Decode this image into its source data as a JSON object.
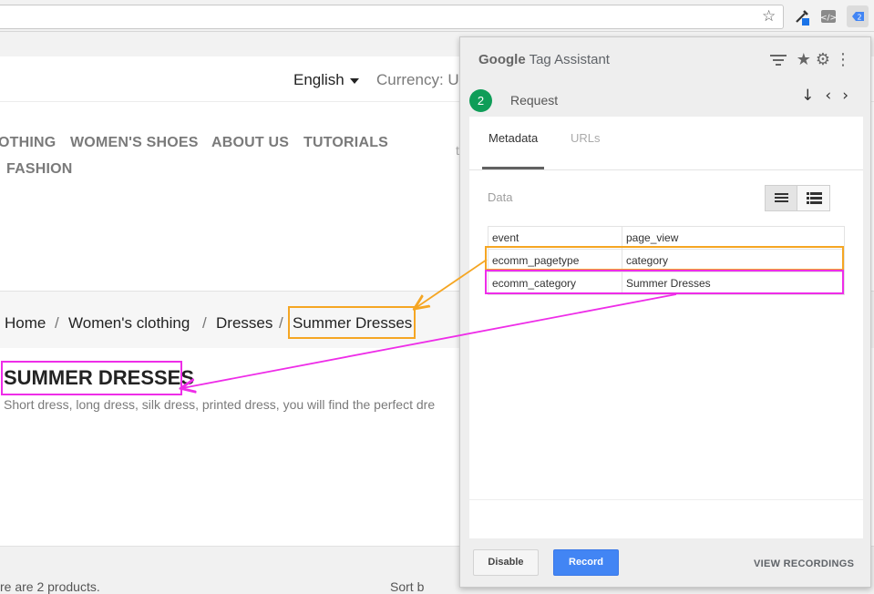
{
  "browser": {
    "star_icon": "star-icon",
    "extensions": [
      "eyedropper-icon",
      "code-view-icon",
      "tag-assistant-icon"
    ]
  },
  "site": {
    "language": "English",
    "currency": "Currency: US",
    "menu": [
      "OTHING",
      "WOMEN'S SHOES",
      "ABOUT US",
      "TUTORIALS",
      "FASHION"
    ],
    "menu_cut": "t",
    "breadcrumb": [
      "Home",
      "Women's clothing",
      "Dresses",
      "Summer Dresses"
    ],
    "breadcrumb_sep": "/",
    "category_title": "SUMMER DRESSES",
    "category_desc": "Short dress, long dress, silk dress, printed dress, you will find the perfect dre",
    "bottom_left": "re are 2 products.",
    "bottom_right": "Sort b"
  },
  "tag_assistant": {
    "brand": "Google",
    "title": "Tag Assistant",
    "header_icons": [
      "filter-icon",
      "star-icon",
      "gear-icon",
      "more-icon"
    ],
    "request_number": "2",
    "request_label": "Request",
    "nav_icons": [
      "arrow-down-icon",
      "chevron-left-icon",
      "chevron-right-icon"
    ],
    "tabs": [
      {
        "label": "Metadata",
        "active": true
      },
      {
        "label": "URLs",
        "active": false
      }
    ],
    "data_label": "Data",
    "rows": [
      {
        "key": "event",
        "value": "page_view"
      },
      {
        "key": "ecomm_pagetype",
        "value": "category"
      },
      {
        "key": "ecomm_category",
        "value": "Summer Dresses"
      }
    ],
    "buttons": {
      "disable": "Disable",
      "record": "Record",
      "view_recordings": "VIEW RECORDINGS"
    }
  },
  "annotations": {
    "orange": "#f5a623",
    "magenta": "#ee2de8"
  }
}
